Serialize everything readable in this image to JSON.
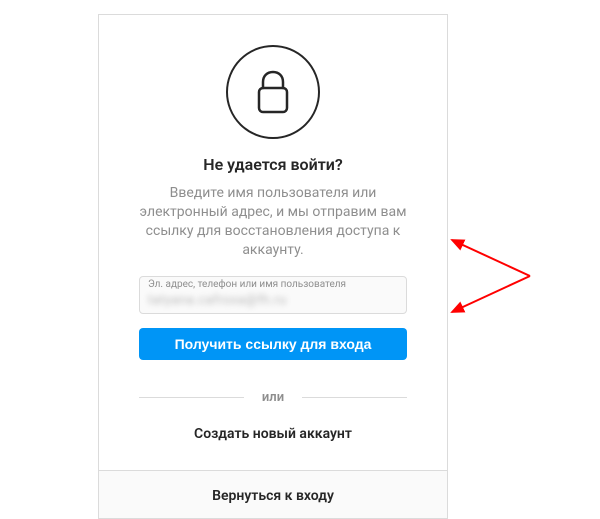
{
  "heading": "Не удается войти?",
  "description": "Введите имя пользователя или электронный адрес, и мы отправим вам ссылку для восстановления доступа к аккаунту.",
  "input": {
    "label": "Эл. адрес, телефон или имя пользователя",
    "value_obscured": "tatyana.cafroxa@fh.ru"
  },
  "submit_button": "Получить ссылку для входа",
  "divider": "или",
  "create_account": "Создать новый аккаунт",
  "back_to_login": "Вернуться к входу",
  "accent_color": "#0095f6",
  "annotation_color": "#ff0000"
}
